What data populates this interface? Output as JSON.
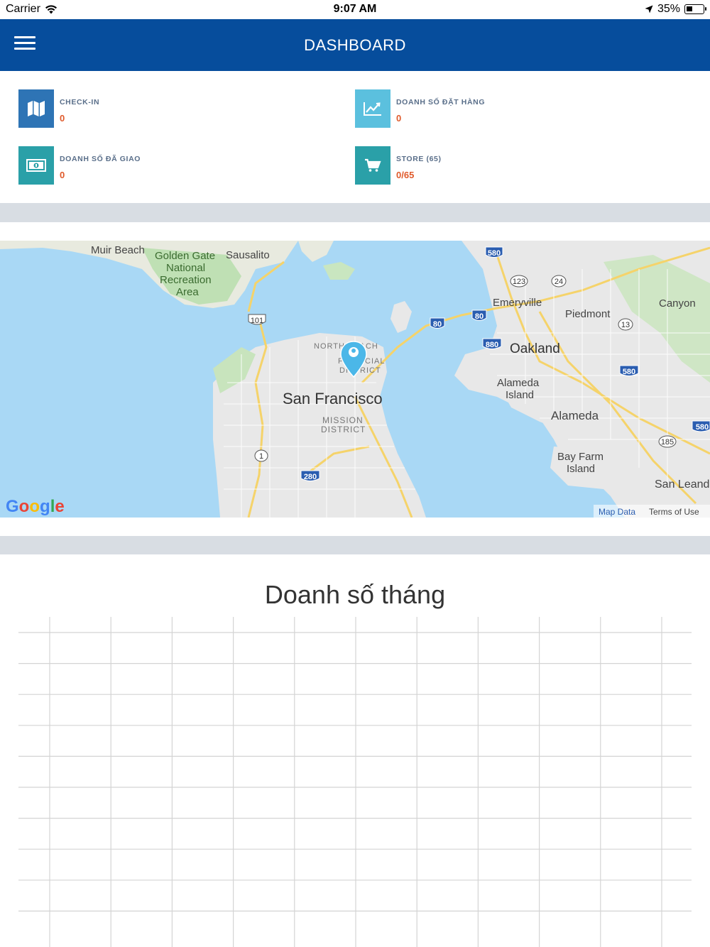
{
  "status_bar": {
    "carrier": "Carrier",
    "time": "9:07 AM",
    "battery": "35%"
  },
  "nav": {
    "title": "DASHBOARD",
    "menu_icon": "hamburger-menu-icon",
    "bar_color": "#064d9c"
  },
  "stats": [
    {
      "label": "CHECK-IN",
      "value": "0",
      "icon": "map-icon",
      "color": "#2e74b5"
    },
    {
      "label": "DOANH SỐ ĐẶT HÀNG",
      "value": "0",
      "icon": "trend-chart-icon",
      "color": "#5bc0de"
    },
    {
      "label": "DOANH SỐ ĐÃ GIAO",
      "value": "0",
      "icon": "money-icon",
      "color": "#2aa0a8"
    },
    {
      "label": "STORE (65)",
      "value": "0/65",
      "icon": "cart-icon",
      "color": "#2aa0a8"
    }
  ],
  "map": {
    "place_labels": {
      "muir_beach": "Muir Beach",
      "golden_gate": "Golden Gate",
      "national": "National",
      "recreation": "Recreation",
      "area": "Area",
      "sausalito": "Sausalito",
      "emeryville": "Emeryville",
      "piedmont": "Piedmont",
      "canyon": "Canyon",
      "oakland": "Oakland",
      "alameda_island_1": "Alameda",
      "alameda_island_2": "Island",
      "alameda": "Alameda",
      "bay_farm_1": "Bay Farm",
      "bay_farm_2": "Island",
      "san_leandro": "San Leand",
      "san_francisco": "San Francisco",
      "north_beach": "NORTH BEACH",
      "financial_1": "FINANCIAL",
      "financial_2": "DISTRICT",
      "mission_1": "MISSION",
      "mission_2": "DISTRICT"
    },
    "shields": {
      "i580_top": "580",
      "r123": "123",
      "r24": "24",
      "i80_a": "80",
      "i80_b": "80",
      "r101": "101",
      "i880": "880",
      "r13": "13",
      "i580_mid": "580",
      "i580_right": "580",
      "r185": "185",
      "r1": "1",
      "i280": "280"
    },
    "logo": "Google",
    "map_data_link": "Map Data",
    "terms_link": "Terms of Use",
    "marker_icon": "location-pin-icon"
  },
  "chart_data": {
    "type": "line",
    "title": "Doanh số tháng",
    "series": [],
    "grid": true
  }
}
